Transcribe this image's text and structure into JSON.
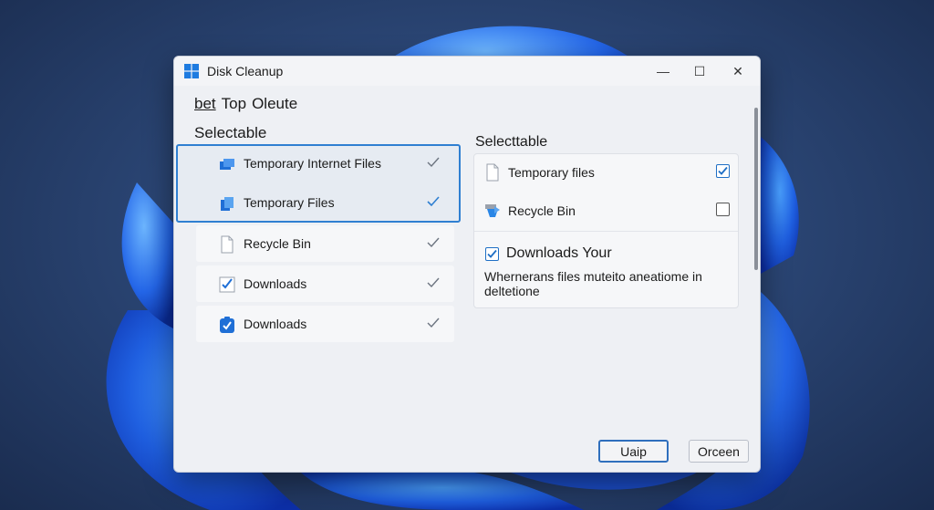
{
  "window": {
    "title": "Disk Cleanup",
    "controls": {
      "minimize": "—",
      "maximize": "☐",
      "close": "✕"
    }
  },
  "menubar": {
    "items": [
      "bet",
      "Top",
      "Oleute"
    ]
  },
  "left_section": {
    "title": "Selectable",
    "items": [
      {
        "label": "Temporary Internet Files",
        "icon": "folder-stack-icon",
        "selected": true,
        "checked": true
      },
      {
        "label": "Temporary Files",
        "icon": "files-icon",
        "selected": true,
        "checked": true
      },
      {
        "label": "Recycle Bin",
        "icon": "document-icon",
        "selected": false,
        "checked": true
      },
      {
        "label": "Downloads",
        "icon": "checklist-icon",
        "selected": false,
        "checked": true
      },
      {
        "label": "Downloads",
        "icon": "shield-check-icon",
        "selected": false,
        "checked": true
      }
    ]
  },
  "right_section": {
    "title": "Selecttable",
    "items": [
      {
        "label": "Temporary files",
        "icon": "document-icon",
        "checked": true
      },
      {
        "label": "Recycle Bin",
        "icon": "recycle-bin-icon",
        "checked": false
      }
    ],
    "detail": {
      "label": "Downloads Your",
      "checked": true,
      "description": "Whernerans files muteito aneatiome in deltetione"
    }
  },
  "buttons": {
    "primary": "Uaip",
    "secondary": "Orceen"
  },
  "colors": {
    "accent": "#2f7fd1",
    "check": "#1f6fc5"
  }
}
